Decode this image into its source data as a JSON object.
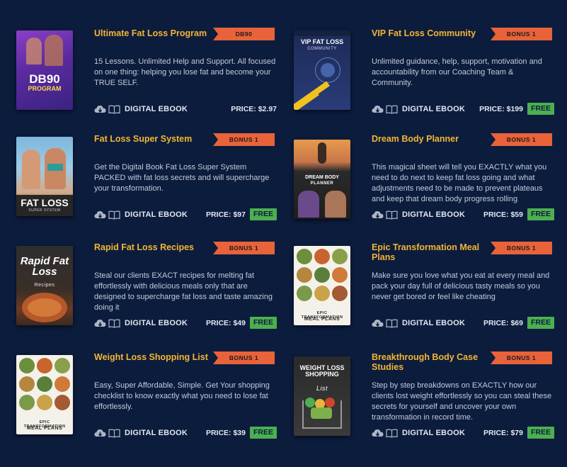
{
  "ebook_label": "DIGITAL EBOOK",
  "colors": {
    "background": "#0c1c3d",
    "title": "#f2b632",
    "ribbon": "#e8623a",
    "free": "#4caf50"
  },
  "products": [
    {
      "title": "Ultimate Fat Loss Program",
      "tag": "DB90",
      "description": "15 Lessons. Unlimited Help and Support. All focused on one thing: helping you lose fat and become your TRUE SELF.",
      "price": "PRICE: $2.97",
      "free": "",
      "cover": {
        "title": "DB90",
        "subtitle": "PROGRAM"
      }
    },
    {
      "title": "VIP Fat Loss Community",
      "tag": "BONUS 1",
      "description": "Unlimited guidance, help, support, motivation and accountability from our Coaching Team & Community.",
      "price": "PRICE: $199",
      "free": "FREE",
      "cover": {
        "title": "VIP FAT LOSS",
        "subtitle": "COMMUNITY"
      }
    },
    {
      "title": "Fat Loss Super System",
      "tag": "BONUS 1",
      "description": "Get the Digital Book Fat Loss Super System PACKED with fat loss secrets and will supercharge your transformation.",
      "price": "PRICE: $97",
      "free": "FREE",
      "cover": {
        "title": "FAT LOSS",
        "subtitle": "SUPER SYSTEM"
      }
    },
    {
      "title": "Dream Body Planner",
      "tag": "BONUS 1",
      "description": "This magical sheet will tell you EXACTLY what you need to do next to keep fat loss going and what adjustments need to be made to prevent plateaus and keep that dream body progress rolling",
      "price": "PRICE: $59",
      "free": "FREE",
      "cover": {
        "title": "DREAM BODY",
        "subtitle": "PLANNER"
      }
    },
    {
      "title": "Rapid Fat Loss Recipes",
      "tag": "BONUS 1",
      "description": "Steal our clients EXACT recipes for melting fat effortlessly with delicious meals only that are designed to supercharge fat loss and taste amazing doing it",
      "price": "PRICE: $49",
      "free": "FREE",
      "cover": {
        "title": "Rapid Fat Loss",
        "subtitle": "Recipes"
      }
    },
    {
      "title": "Epic Transformation Meal Plans",
      "tag": "BONUS 1",
      "description": "Make sure you love what you eat at every meal and pack your day full of delicious tasty meals so you never get bored or feel like cheating",
      "price": "PRICE: $69",
      "free": "FREE",
      "cover": {
        "title": "EPIC TRANSFORMATION",
        "subtitle": "MEAL PLANS"
      }
    },
    {
      "title": "Weight Loss Shopping List",
      "tag": "BONUS 1",
      "description": "Easy, Super Affordable, Simple. Get Your shopping checklist to know exactly what you need to lose fat effortlessly.",
      "price": "PRICE: $39",
      "free": "FREE",
      "cover": {
        "title": "EPIC TRANSFORMATION",
        "subtitle": "MEAL PLANS"
      }
    },
    {
      "title": "Breakthrough Body Case Studies",
      "tag": "BONUS 1",
      "description": "Step by step breakdowns on EXACTLY how our clients lost weight effortlessly so you can steal these secrets for yourself and uncover your own transformation in record time.",
      "price": "PRICE: $79",
      "free": "FREE",
      "cover": {
        "title": "WEIGHT LOSS SHOPPING",
        "subtitle": "List"
      }
    }
  ]
}
